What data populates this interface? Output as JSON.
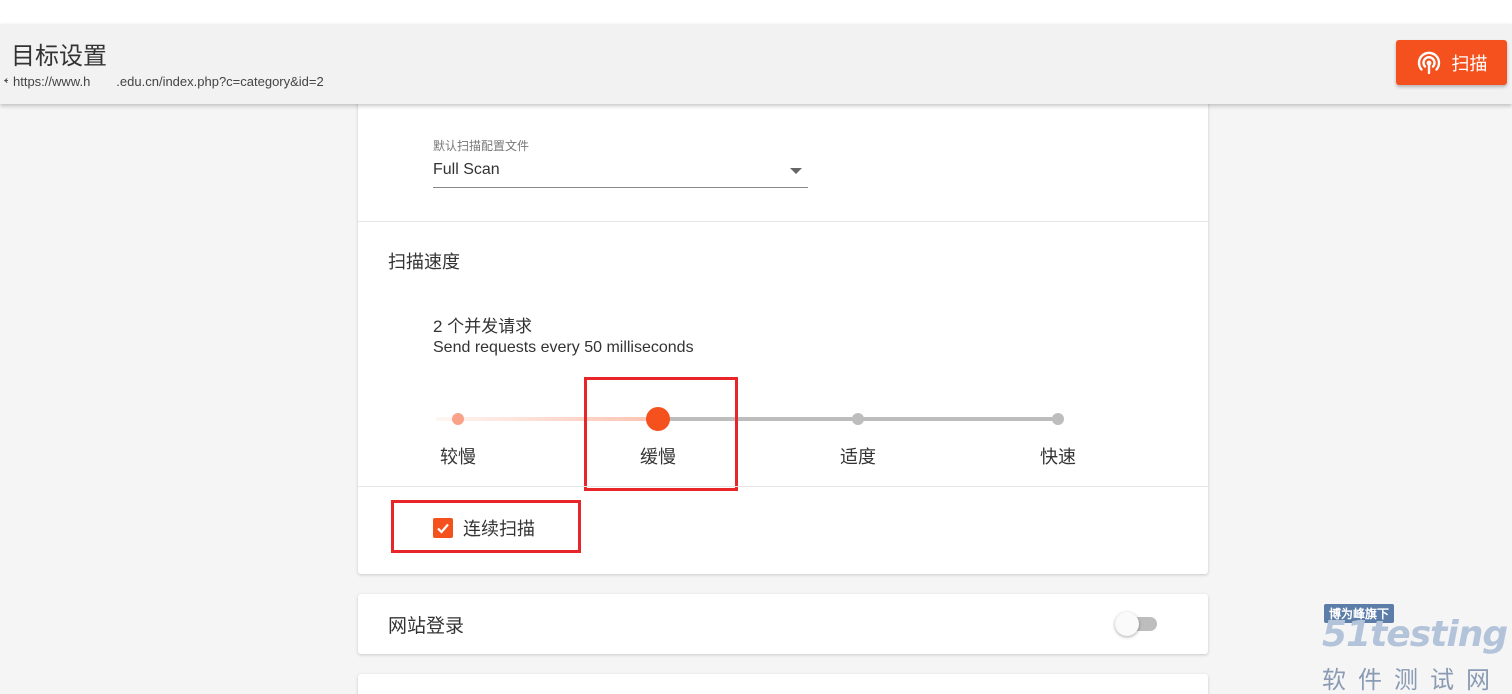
{
  "header": {
    "back_symbol": "←",
    "title": "目标设置",
    "url": "https://www.h  .edu.cn/index.php?c=category&id=2",
    "scan_button_label": "扫描"
  },
  "scan_settings": {
    "profile_label": "默认扫描配置文件",
    "profile_value": "Full Scan",
    "speed_section_title": "扫描速度",
    "concurrency_text": "2 个并发请求",
    "interval_text": "Send requests every 50 milliseconds",
    "speed_options": [
      "较慢",
      "缓慢",
      "适度",
      "快速"
    ],
    "selected_speed": "缓慢",
    "continuous_scan_label": "连续扫描",
    "continuous_scan_checked": true
  },
  "site_login": {
    "title": "网站登录",
    "enabled": false
  },
  "watermark": {
    "badge": "博为峰旗下",
    "word": "51testing",
    "sub": "软件测试网"
  },
  "colors": {
    "accent": "#f4511e",
    "highlight": "#e8262a"
  }
}
